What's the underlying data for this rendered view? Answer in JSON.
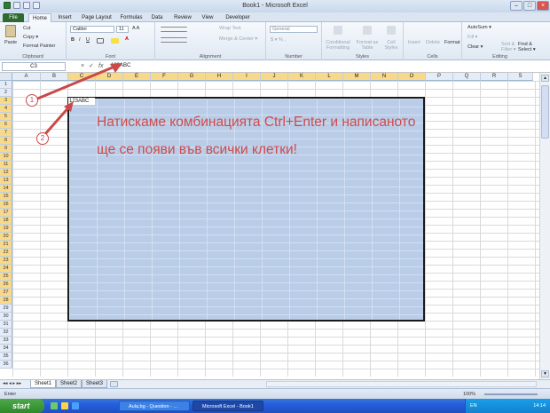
{
  "window": {
    "title": "Book1 - Microsoft Excel"
  },
  "tabs": [
    "File",
    "Home",
    "Insert",
    "Page Layout",
    "Formulas",
    "Data",
    "Review",
    "View",
    "Developer"
  ],
  "ribbon": {
    "clipboard": {
      "paste": "Paste",
      "cut": "Cut",
      "copy": "Copy ▾",
      "format_painter": "Format Painter",
      "label": "Clipboard"
    },
    "font": {
      "name": "Calibri",
      "size": "11",
      "label": "Font"
    },
    "alignment": {
      "wrap": "Wrap Text",
      "merge": "Merge & Center ▾",
      "label": "Alignment"
    },
    "number": {
      "format": "General",
      "label": "Number"
    },
    "styles": {
      "conditional": "Conditional Formatting",
      "format_table": "Format as Table",
      "cell_styles": "Cell Styles",
      "label": "Styles"
    },
    "cells": {
      "insert": "Insert",
      "delete": "Delete",
      "format": "Format",
      "label": "Cells"
    },
    "editing": {
      "autosum": "AutoSum ▾",
      "fill": "Fill ▾",
      "clear": "Clear ▾",
      "sort": "Sort & Filter ▾",
      "find": "Find & Select ▾",
      "label": "Editing"
    }
  },
  "formula_bar": {
    "name_box": "C3",
    "value": "123ABC"
  },
  "columns": [
    "A",
    "B",
    "C",
    "D",
    "E",
    "F",
    "G",
    "H",
    "I",
    "J",
    "K",
    "L",
    "M",
    "N",
    "O",
    "P",
    "Q",
    "R",
    "S"
  ],
  "rows": [
    "1",
    "2",
    "3",
    "4",
    "5",
    "6",
    "7",
    "8",
    "9",
    "10",
    "11",
    "12",
    "13",
    "14",
    "15",
    "16",
    "17",
    "18",
    "19",
    "20",
    "21",
    "22",
    "23",
    "24",
    "25",
    "26",
    "27",
    "28",
    "29",
    "30",
    "31",
    "32",
    "33",
    "34",
    "35",
    "36"
  ],
  "selected_columns": [
    "C",
    "D",
    "E",
    "F",
    "G",
    "H",
    "I",
    "J",
    "K",
    "L",
    "M",
    "N",
    "O"
  ],
  "selected_rows_from": 3,
  "selected_rows_to": 28,
  "active_cell_value": "123ABC",
  "annotation": {
    "line1": "Натискаме комбинацията Ctrl+Enter и написаното",
    "line2": "ще се появи във всички клетки!",
    "callout1": "1",
    "callout2": "2",
    "color": "#d04a4a"
  },
  "sheets": [
    "Sheet1",
    "Sheet2",
    "Sheet3"
  ],
  "status": {
    "mode": "Enter",
    "zoom": "100%"
  },
  "taskbar": {
    "start": "start",
    "items": [
      "Aula.bg - Question - ...",
      "Microsoft Excel - Book1"
    ],
    "lang": "EN",
    "time": "14:14"
  }
}
